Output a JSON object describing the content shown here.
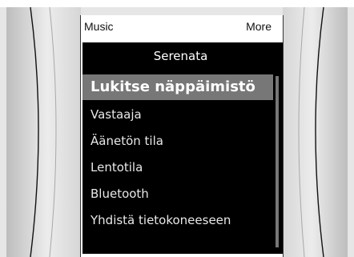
{
  "softkeys": {
    "left": "Music",
    "right": "More"
  },
  "menu": {
    "title": "Serenata",
    "items": [
      "Lukitse näppäimistö",
      "Vastaaja",
      "Äänetön tila",
      "Lentotila",
      "Bluetooth",
      "Yhdistä tietokoneeseen"
    ],
    "selected_index": 0
  },
  "colors": {
    "background": "#ffffff",
    "bezel": "#dcdcdc",
    "panel": "#000000",
    "highlight": "#777777"
  }
}
